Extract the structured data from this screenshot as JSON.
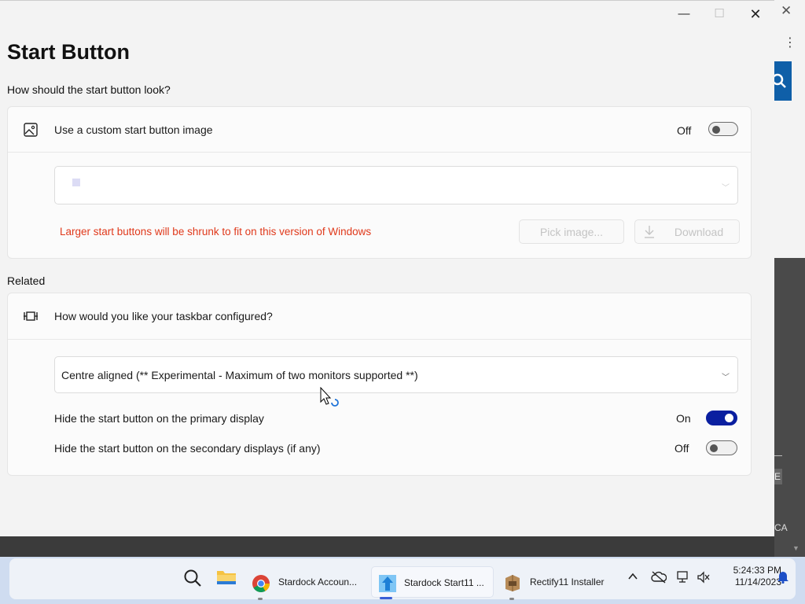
{
  "window": {
    "title": "Start Button",
    "controls": {
      "minimize": "—",
      "maximize": "☐",
      "close": "✕"
    }
  },
  "look_section": {
    "heading": "How should the start button look?",
    "custom_image": {
      "label": "Use a custom start button image",
      "state_text": "Off",
      "enabled": false
    },
    "image_dropdown": {
      "value": ""
    },
    "warning": "Larger start buttons will be shrunk to fit on this version of Windows",
    "pick_image_label": "Pick image...",
    "download_label": "Download"
  },
  "related_section": {
    "heading": "Related",
    "taskbar_question": "How would you like your taskbar configured?",
    "alignment_dropdown": {
      "value": "Centre aligned (** Experimental - Maximum of two monitors supported **)"
    },
    "hide_primary": {
      "label": "Hide the start button on the primary display",
      "state_text": "On",
      "enabled": true
    },
    "hide_secondary": {
      "label": "Hide the start button on the secondary displays (if any)",
      "state_text": "Off",
      "enabled": false
    }
  },
  "background_app": {
    "close": "✕",
    "menu": "⋮",
    "edge_text_e": "E",
    "edge_text_ca": "CA"
  },
  "taskbar": {
    "items": [
      {
        "label": "Stardock Accoun..."
      },
      {
        "label": "Stardock Start11 ..."
      },
      {
        "label": "Rectify11 Installer"
      }
    ],
    "clock": {
      "time": "5:24:33 PM",
      "date": "11/14/2023"
    }
  },
  "colors": {
    "accent": "#0a1fa0",
    "warning": "#e0391b"
  }
}
